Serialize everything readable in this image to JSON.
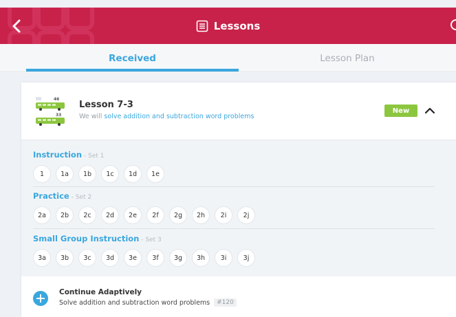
{
  "header": {
    "title": "Lessons",
    "bg_color": "#c8224a"
  },
  "tabs": [
    {
      "label": "Received",
      "active": true
    },
    {
      "label": "Lesson Plan",
      "active": false
    }
  ],
  "lesson": {
    "title": "Lesson 7-3",
    "desc_prefix": "We will ",
    "desc_highlight": "solve addition and subtraction word problems",
    "badge": "New",
    "art": {
      "top_count": "46",
      "bottom_count": "33"
    }
  },
  "sets": [
    {
      "label": "Instruction",
      "sub": " - Set 1",
      "items": [
        "1",
        "1a",
        "1b",
        "1c",
        "1d",
        "1e"
      ]
    },
    {
      "label": "Practice",
      "sub": " - Set 2",
      "items": [
        "2a",
        "2b",
        "2c",
        "2d",
        "2e",
        "2f",
        "2g",
        "2h",
        "2i",
        "2j"
      ]
    },
    {
      "label": "Small Group Instruction",
      "sub": " - Set 3",
      "items": [
        "3a",
        "3b",
        "3c",
        "3d",
        "3e",
        "3f",
        "3g",
        "3h",
        "3i",
        "3j"
      ]
    }
  ],
  "continue": {
    "title": "Continue Adaptively",
    "desc": "Solve addition and subtraction word problems",
    "id": "#120"
  },
  "colors": {
    "accent": "#3aa7de",
    "new_badge": "#8cc63f",
    "bus": "#8cc63f"
  }
}
